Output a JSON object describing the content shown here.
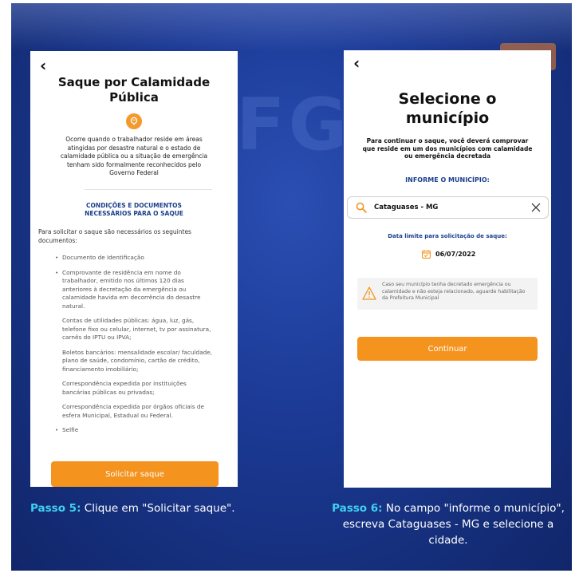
{
  "left_screen": {
    "title": "Saque por Calamidade Pública",
    "description": "Ocorre quando o trabalhador reside em áreas atingidas por desastre natural e o estado de calamidade pública ou a situação de emergência tenham sido formalmente reconhecidos pelo Governo Federal",
    "conditions_title": "CONDIÇÕES E DOCUMENTOS NECESSÁRIOS PARA O SAQUE",
    "intro": "Para solicitar o saque são necessários os seguintes documentos:",
    "documents": [
      "Documento de Identificação",
      "Comprovante de residência em nome do trabalhador, emitido nos últimos 120 dias anteriores à decretação da emergência ou calamidade havida em decorrência do desastre natural."
    ],
    "proof_options": [
      "Contas de utilidades públicas: água, luz, gás, telefone fixo ou celular, internet, tv por assinatura, carnês do IPTU ou IPVA;",
      "Boletos bancários: mensalidade escolar/ faculdade, plano de saúde, condomínio, cartão de crédito, financiamento imobiliário;",
      "Correspondência expedida por instituições bancárias públicas ou privadas;",
      "Correspondência expedida por órgãos oficiais de esfera Municipal, Estadual ou Federal."
    ],
    "last_document": "Selfie",
    "button_label": "Solicitar saque"
  },
  "right_screen": {
    "title": "Selecione o município",
    "description": "Para continuar o saque, você deverá comprovar que reside em um dos municípios com calamidade ou emergência decretada",
    "input_label": "INFORME O MUNICÍPIO:",
    "search_value": "Cataguases - MG",
    "deadline_label": "Data limite para solicitação de saque:",
    "deadline_date": "06/07/2022",
    "warning_text": "Caso seu município tenha decretado emergência ou calamidade e não esteja relacionado, aguarde habilitação da Prefeitura Municipal",
    "button_label": "Continuar"
  },
  "captions": {
    "left_step": "Passo 5:",
    "left_text": " Clique em \"Solicitar saque\".",
    "right_step": "Passo 6:",
    "right_text": " No campo \"informe o município\", escreva Cataguases - MG e selecione a cidade."
  },
  "colors": {
    "accent_orange": "#f4931e",
    "heading_blue": "#1d3f8c",
    "step_cyan": "#3ed1f2",
    "background_blue": "#1c3a96"
  },
  "icons": {
    "back": "back-arrow-icon",
    "info": "info-icon",
    "search": "search-icon",
    "clear": "close-icon",
    "calendar": "calendar-icon",
    "warning": "warning-icon"
  }
}
